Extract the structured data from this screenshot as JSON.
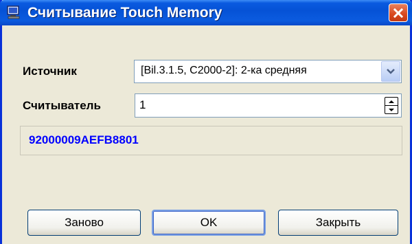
{
  "window": {
    "title": "Считывание Touch Memory",
    "title_icon": "computer-icon",
    "close_icon": "close-icon"
  },
  "form": {
    "source_label": "Источник",
    "source_value": "[Bil.3.1.5, C2000-2]: 2-ка средняя",
    "reader_label": "Считыватель",
    "reader_value": "1",
    "result_value": "92000009AEFB8801"
  },
  "buttons": {
    "retry": "Заново",
    "ok": "OK",
    "close": "Закрыть"
  },
  "colors": {
    "titlebar": "#0552d6",
    "result_text": "#0000ff",
    "close_button": "#d9471e"
  }
}
